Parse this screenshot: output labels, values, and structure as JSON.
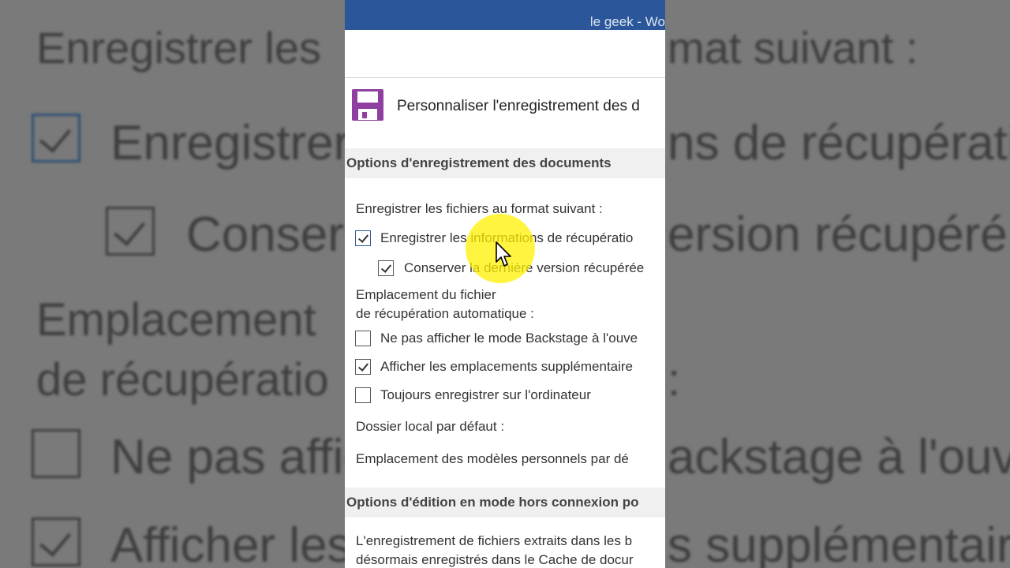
{
  "background": {
    "line1": "Enregistrer les",
    "line1_right": "mat suivant :",
    "line2": "Enregistrer",
    "line2_right": "ns de récupératio",
    "line3": "Conser",
    "line3_right": "ersion récupéré",
    "line4": "Emplacement",
    "line5": "de récupératio",
    "line5_right": ":",
    "line6": "Ne pas affic",
    "line6_right": "ackstage à l'ouve",
    "line7": "Afficher les",
    "line7_right": "s supplémentaire"
  },
  "window": {
    "title": "le geek  -  Wo",
    "accent": "#2b579a"
  },
  "dialog": {
    "heading": "Personnaliser l'enregistrement des d",
    "section1": "Options d'enregistrement des documents",
    "format_label": "Enregistrer les fichiers au format suivant :",
    "cb_save_recovery": "Enregistrer les informations de récupératio",
    "cb_keep_last": "Conserver la dernière version récupérée",
    "autorecover_label_1": "Emplacement du fichier",
    "autorecover_label_2": "de récupération automatique :",
    "cb_backstage": "Ne pas afficher le mode Backstage à l'ouve",
    "cb_show_locations": "Afficher les emplacements supplémentaire",
    "cb_always_computer": "Toujours enregistrer sur l'ordinateur",
    "local_folder_label": "Dossier local par défaut :",
    "templates_label": "Emplacement des modèles personnels par dé",
    "section2": "Options d'édition en mode hors connexion po",
    "offline_text_1": "L'enregistrement de fichiers extraits dans les b",
    "offline_text_2": "désormais enregistrés dans le Cache de docur"
  },
  "states": {
    "save_recovery": true,
    "keep_last": true,
    "backstage": false,
    "show_locations": true,
    "always_computer": false
  },
  "icons": {
    "save": "floppy-disk-icon",
    "cursor": "mouse-pointer-icon"
  }
}
